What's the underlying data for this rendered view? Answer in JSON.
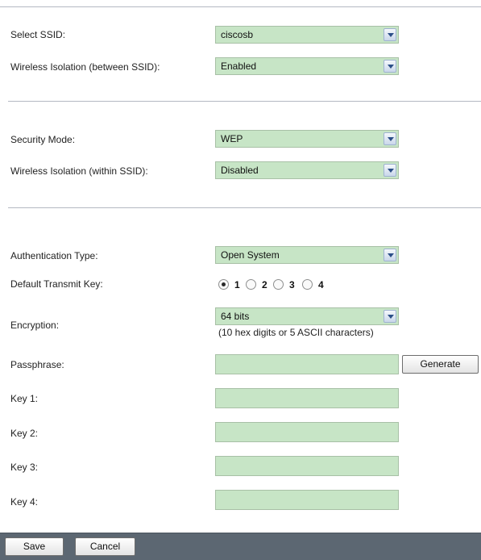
{
  "ssid_section": {
    "select_ssid_label": "Select SSID:",
    "select_ssid_value": "ciscosb",
    "isolation_between_label": "Wireless Isolation (between SSID):",
    "isolation_between_value": "Enabled"
  },
  "security_section": {
    "security_mode_label": "Security Mode:",
    "security_mode_value": "WEP",
    "isolation_within_label": "Wireless Isolation (within SSID):",
    "isolation_within_value": "Disabled"
  },
  "wep_section": {
    "auth_type_label": "Authentication Type:",
    "auth_type_value": "Open System",
    "default_key_label": "Default Transmit Key:",
    "default_key_options": [
      "1",
      "2",
      "3",
      "4"
    ],
    "default_key_selected": "1",
    "encryption_label": "Encryption:",
    "encryption_value": "64 bits",
    "encryption_note": "(10 hex digits or 5 ASCII characters)",
    "passphrase_label": "Passphrase:",
    "passphrase_value": "",
    "generate_label": "Generate",
    "key1_label": "Key 1:",
    "key1_value": "",
    "key2_label": "Key 2:",
    "key2_value": "",
    "key3_label": "Key 3:",
    "key3_value": "",
    "key4_label": "Key 4:",
    "key4_value": ""
  },
  "footer": {
    "save_label": "Save",
    "cancel_label": "Cancel"
  },
  "colors": {
    "field_bg": "#c7e5c6",
    "footer_bg": "#5c6772"
  }
}
